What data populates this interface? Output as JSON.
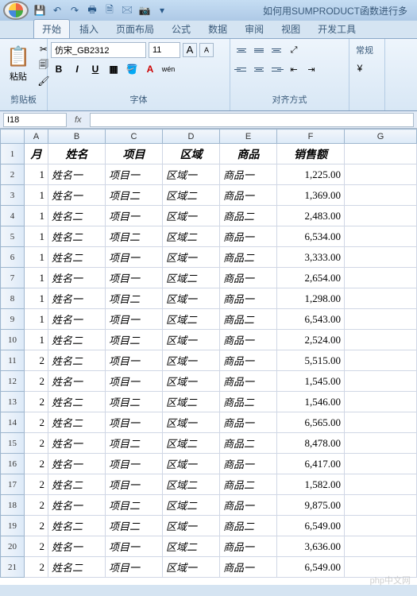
{
  "title": "如何用SUMPRODUCT函数进行多",
  "qat_icons": [
    "save-icon",
    "undo-icon",
    "redo-icon",
    "print-icon",
    "new-icon",
    "open-icon",
    "camera-icon"
  ],
  "tabs": [
    {
      "label": "开始",
      "active": true
    },
    {
      "label": "插入",
      "active": false
    },
    {
      "label": "页面布局",
      "active": false
    },
    {
      "label": "公式",
      "active": false
    },
    {
      "label": "数据",
      "active": false
    },
    {
      "label": "审阅",
      "active": false
    },
    {
      "label": "视图",
      "active": false
    },
    {
      "label": "开发工具",
      "active": false
    }
  ],
  "ribbon": {
    "clipboard": {
      "paste": "粘贴",
      "label": "剪贴板"
    },
    "font": {
      "name": "仿宋_GB2312",
      "size": "11",
      "label": "字体",
      "grow": "A",
      "shrink": "A",
      "bold": "B",
      "italic": "I",
      "underline": "U",
      "wen": "wén"
    },
    "align": {
      "label": "对齐方式"
    },
    "general": {
      "label": "常规"
    }
  },
  "namebox": "I18",
  "fx": "fx",
  "columns": [
    "",
    "A",
    "B",
    "C",
    "D",
    "E",
    "F",
    "G"
  ],
  "headers": {
    "A": "月",
    "B": "姓名",
    "C": "项目",
    "D": "区域",
    "E": "商品",
    "F": "销售额"
  },
  "rows": [
    {
      "n": 2,
      "m": "1",
      "name": "姓名一",
      "proj": "项目一",
      "area": "区域一",
      "prod": "商品一",
      "amt": "1,225.00"
    },
    {
      "n": 3,
      "m": "1",
      "name": "姓名一",
      "proj": "项目二",
      "area": "区域二",
      "prod": "商品一",
      "amt": "1,369.00"
    },
    {
      "n": 4,
      "m": "1",
      "name": "姓名二",
      "proj": "项目一",
      "area": "区域一",
      "prod": "商品二",
      "amt": "2,483.00"
    },
    {
      "n": 5,
      "m": "1",
      "name": "姓名二",
      "proj": "项目二",
      "area": "区域二",
      "prod": "商品一",
      "amt": "6,534.00"
    },
    {
      "n": 6,
      "m": "1",
      "name": "姓名二",
      "proj": "项目一",
      "area": "区域一",
      "prod": "商品二",
      "amt": "3,333.00"
    },
    {
      "n": 7,
      "m": "1",
      "name": "姓名一",
      "proj": "项目一",
      "area": "区域二",
      "prod": "商品一",
      "amt": "2,654.00"
    },
    {
      "n": 8,
      "m": "1",
      "name": "姓名一",
      "proj": "项目二",
      "area": "区域一",
      "prod": "商品一",
      "amt": "1,298.00"
    },
    {
      "n": 9,
      "m": "1",
      "name": "姓名一",
      "proj": "项目一",
      "area": "区域二",
      "prod": "商品二",
      "amt": "6,543.00"
    },
    {
      "n": 10,
      "m": "1",
      "name": "姓名二",
      "proj": "项目二",
      "area": "区域一",
      "prod": "商品一",
      "amt": "2,524.00"
    },
    {
      "n": 11,
      "m": "2",
      "name": "姓名二",
      "proj": "项目一",
      "area": "区域一",
      "prod": "商品一",
      "amt": "5,515.00"
    },
    {
      "n": 12,
      "m": "2",
      "name": "姓名一",
      "proj": "项目一",
      "area": "区域一",
      "prod": "商品一",
      "amt": "1,545.00"
    },
    {
      "n": 13,
      "m": "2",
      "name": "姓名二",
      "proj": "项目二",
      "area": "区域二",
      "prod": "商品二",
      "amt": "1,546.00"
    },
    {
      "n": 14,
      "m": "2",
      "name": "姓名二",
      "proj": "项目一",
      "area": "区域一",
      "prod": "商品一",
      "amt": "6,565.00"
    },
    {
      "n": 15,
      "m": "2",
      "name": "姓名一",
      "proj": "项目二",
      "area": "区域二",
      "prod": "商品二",
      "amt": "8,478.00"
    },
    {
      "n": 16,
      "m": "2",
      "name": "姓名一",
      "proj": "项目一",
      "area": "区域一",
      "prod": "商品一",
      "amt": "6,417.00"
    },
    {
      "n": 17,
      "m": "2",
      "name": "姓名二",
      "proj": "项目一",
      "area": "区域二",
      "prod": "商品二",
      "amt": "1,582.00"
    },
    {
      "n": 18,
      "m": "2",
      "name": "姓名一",
      "proj": "项目二",
      "area": "区域二",
      "prod": "商品一",
      "amt": "9,875.00"
    },
    {
      "n": 19,
      "m": "2",
      "name": "姓名二",
      "proj": "项目二",
      "area": "区域一",
      "prod": "商品二",
      "amt": "6,549.00"
    },
    {
      "n": 20,
      "m": "2",
      "name": "姓名一",
      "proj": "项目一",
      "area": "区域二",
      "prod": "商品一",
      "amt": "3,636.00"
    },
    {
      "n": 21,
      "m": "2",
      "name": "姓名二",
      "proj": "项目一",
      "area": "区域一",
      "prod": "商品一",
      "amt": "6,549.00"
    }
  ],
  "watermark": "php中文网"
}
